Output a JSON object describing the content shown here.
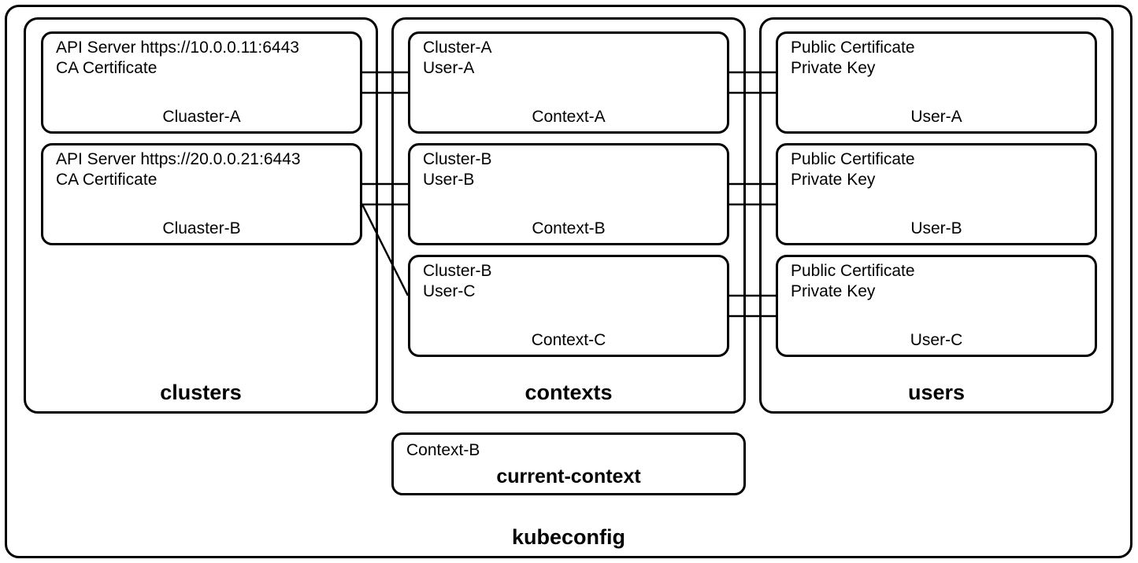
{
  "kubeconfig_label": "kubeconfig",
  "clusters": {
    "label": "clusters",
    "items": [
      {
        "line1": "API Server https://10.0.0.11:6443",
        "line2": "CA Certificate",
        "name": "Cluaster-A"
      },
      {
        "line1": "API Server https://20.0.0.21:6443",
        "line2": "CA Certificate",
        "name": "Cluaster-B"
      }
    ]
  },
  "contexts": {
    "label": "contexts",
    "items": [
      {
        "line1": "Cluster-A",
        "line2": "User-A",
        "name": "Context-A"
      },
      {
        "line1": "Cluster-B",
        "line2": "User-B",
        "name": "Context-B"
      },
      {
        "line1": "Cluster-B",
        "line2": "User-C",
        "name": "Context-C"
      }
    ]
  },
  "users": {
    "label": "users",
    "items": [
      {
        "line1": "Public Certificate",
        "line2": "Private Key",
        "name": "User-A"
      },
      {
        "line1": "Public Certificate",
        "line2": "Private Key",
        "name": "User-B"
      },
      {
        "line1": "Public Certificate",
        "line2": "Private Key",
        "name": "User-C"
      }
    ]
  },
  "current_context": {
    "label": "current-context",
    "value": "Context-B"
  }
}
